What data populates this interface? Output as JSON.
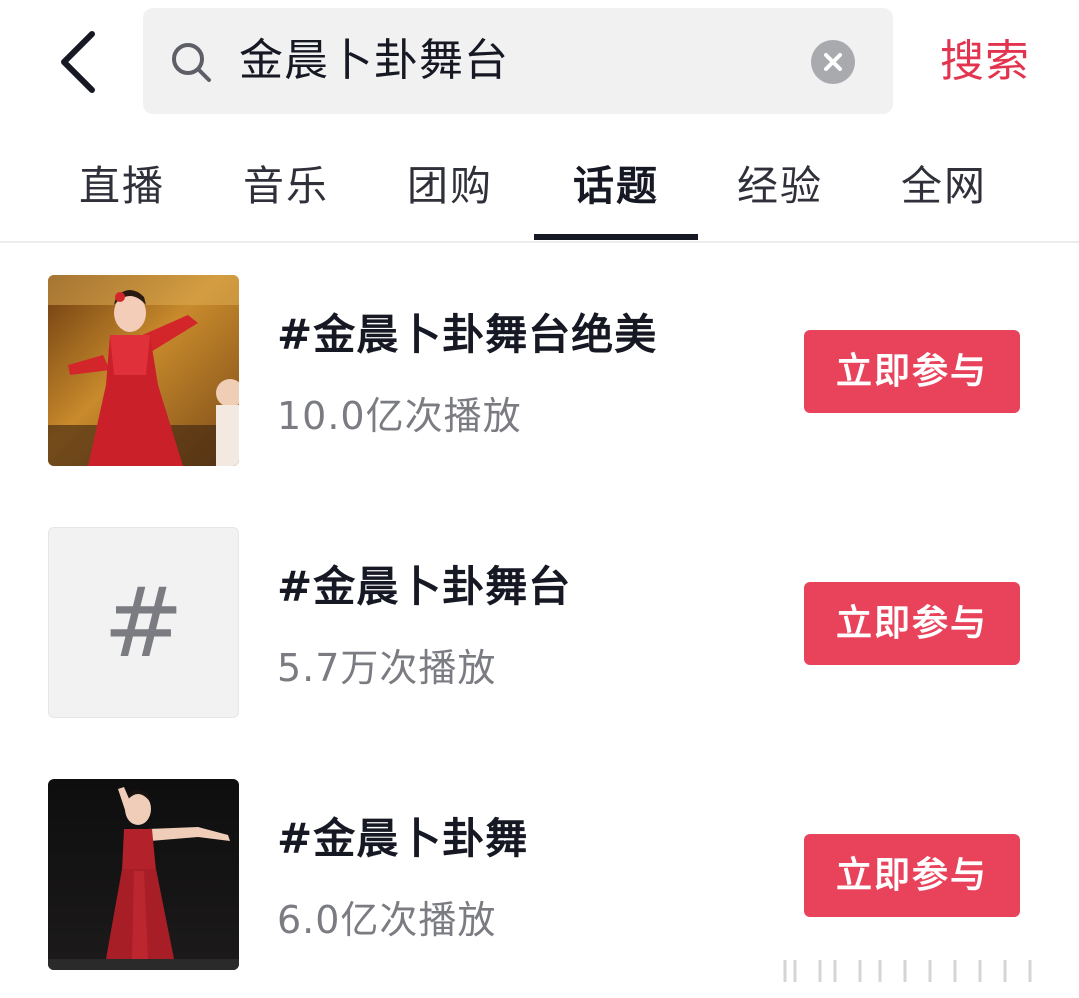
{
  "header": {
    "search_query": "金晨卜卦舞台",
    "search_button": "搜索"
  },
  "tabs": [
    {
      "label": "直播",
      "active": false
    },
    {
      "label": "音乐",
      "active": false
    },
    {
      "label": "团购",
      "active": false
    },
    {
      "label": "话题",
      "active": true
    },
    {
      "label": "经验",
      "active": false
    },
    {
      "label": "全网",
      "active": false
    }
  ],
  "topics": [
    {
      "title": "#金晨卜卦舞台绝美",
      "plays": "10.0亿次播放",
      "join_label": "立即参与",
      "thumbnail": "dancer-red-stage-photo"
    },
    {
      "title": "#金晨卜卦舞台",
      "plays": "5.7万次播放",
      "join_label": "立即参与",
      "thumbnail": "hashtag-placeholder",
      "placeholder_glyph": "#"
    },
    {
      "title": "#金晨卜卦舞",
      "plays": "6.0亿次播放",
      "join_label": "立即参与",
      "thumbnail": "dancer-red-dress-dark-photo"
    }
  ],
  "colors": {
    "accent": "#e3344f",
    "button_bg": "#e9435c",
    "text_primary": "#161823",
    "text_secondary": "#7b7c82",
    "search_bg": "#f1f1f2"
  }
}
